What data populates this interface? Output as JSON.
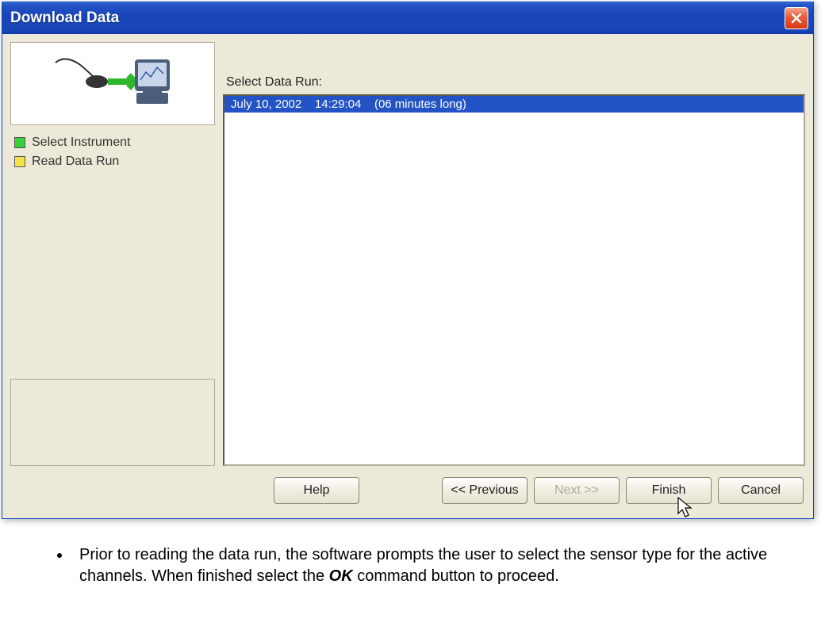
{
  "window": {
    "title": "Download Data"
  },
  "sidebar": {
    "steps": [
      {
        "label": "Select Instrument",
        "state": "done"
      },
      {
        "label": "Read Data Run",
        "state": "current"
      }
    ]
  },
  "main": {
    "list_label": "Select Data Run:",
    "rows": [
      "July 10, 2002    14:29:04    (06 minutes long)"
    ]
  },
  "buttons": {
    "help": "Help",
    "previous": "<< Previous",
    "next": "Next >>",
    "finish": "Finish",
    "cancel": "Cancel"
  },
  "doc": {
    "bullet_pre": "Prior to reading the data run, the software prompts the user to select the sensor type for the active channels. When finished select the ",
    "bullet_ok": "OK",
    "bullet_post": " command button to proceed."
  }
}
